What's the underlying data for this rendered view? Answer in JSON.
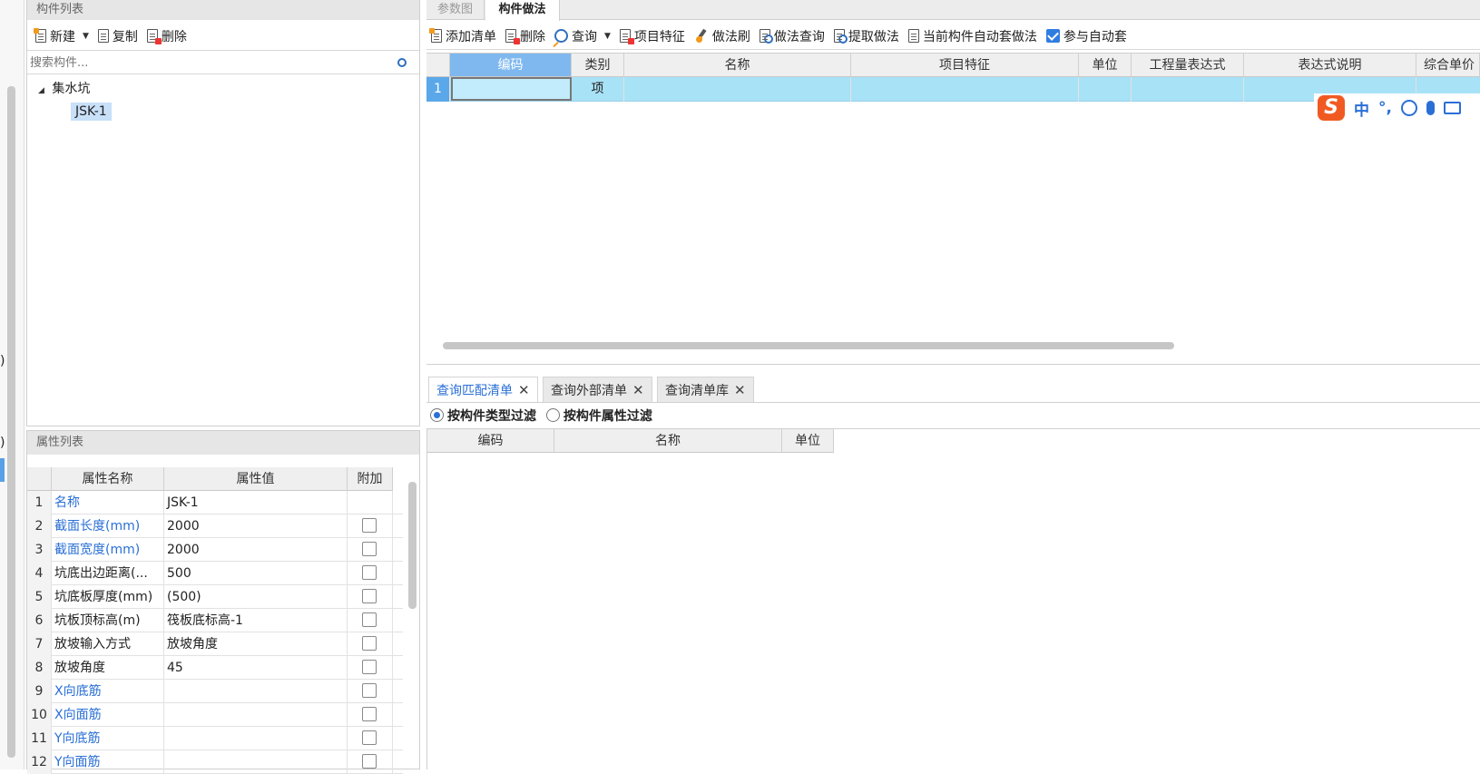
{
  "left_top": {
    "title": "构件列表",
    "toolbar": {
      "new_label": "新建",
      "copy_label": "复制",
      "delete_label": "删除"
    },
    "search_placeholder": "搜索构件...",
    "tree": {
      "group": "集水坑",
      "item": "JSK-1"
    }
  },
  "left_bottom": {
    "title": "属性列表",
    "columns": [
      "属性名称",
      "属性值",
      "附加"
    ],
    "rows": [
      {
        "n": "1",
        "name": "名称",
        "value": "JSK-1",
        "blue": true,
        "checkbox": false
      },
      {
        "n": "2",
        "name": "截面长度(mm)",
        "value": "2000",
        "blue": true,
        "checkbox": true
      },
      {
        "n": "3",
        "name": "截面宽度(mm)",
        "value": "2000",
        "blue": true,
        "checkbox": true
      },
      {
        "n": "4",
        "name": "坑底出边距离(...",
        "value": "500",
        "blue": false,
        "checkbox": true
      },
      {
        "n": "5",
        "name": "坑底板厚度(mm)",
        "value": "(500)",
        "blue": false,
        "checkbox": true
      },
      {
        "n": "6",
        "name": "坑板顶标高(m)",
        "value": "筏板底标高-1",
        "blue": false,
        "checkbox": true
      },
      {
        "n": "7",
        "name": "放坡输入方式",
        "value": "放坡角度",
        "blue": false,
        "checkbox": true
      },
      {
        "n": "8",
        "name": "放坡角度",
        "value": "45",
        "blue": false,
        "checkbox": true
      },
      {
        "n": "9",
        "name": "X向底筋",
        "value": "",
        "blue": true,
        "checkbox": true
      },
      {
        "n": "10",
        "name": "X向面筋",
        "value": "",
        "blue": true,
        "checkbox": true
      },
      {
        "n": "11",
        "name": "Y向底筋",
        "value": "",
        "blue": true,
        "checkbox": true
      },
      {
        "n": "12",
        "name": "Y向面筋",
        "value": "",
        "blue": true,
        "checkbox": true
      }
    ]
  },
  "right_tabs": {
    "tab1": "参数图",
    "tab2": "构件做法"
  },
  "right_toolbar": {
    "add_list": "添加清单",
    "delete": "删除",
    "query": "查询",
    "feature": "项目特征",
    "method_brush": "做法刷",
    "method_query": "做法查询",
    "extract": "提取做法",
    "auto_apply": "当前构件自动套做法",
    "participate": "参与自动套"
  },
  "method_grid": {
    "columns": [
      "编码",
      "类别",
      "名称",
      "项目特征",
      "单位",
      "工程量表达式",
      "表达式说明",
      "综合单价"
    ],
    "rows": [
      {
        "n": "1",
        "code": "",
        "type": "项",
        "name": "",
        "feature": "",
        "unit": "",
        "expr": "",
        "desc": ""
      }
    ]
  },
  "ime": {
    "lang": "中",
    "punct": "°,"
  },
  "bottom_tabs": {
    "t1": "查询匹配清单",
    "t2": "查询外部清单",
    "t3": "查询清单库"
  },
  "filters": {
    "f1": "按构件类型过滤",
    "f2": "按构件属性过滤"
  },
  "match_grid": {
    "columns": [
      "编码",
      "名称",
      "单位"
    ]
  },
  "edge_marks": {
    "m1": ")",
    "m2": ")"
  }
}
